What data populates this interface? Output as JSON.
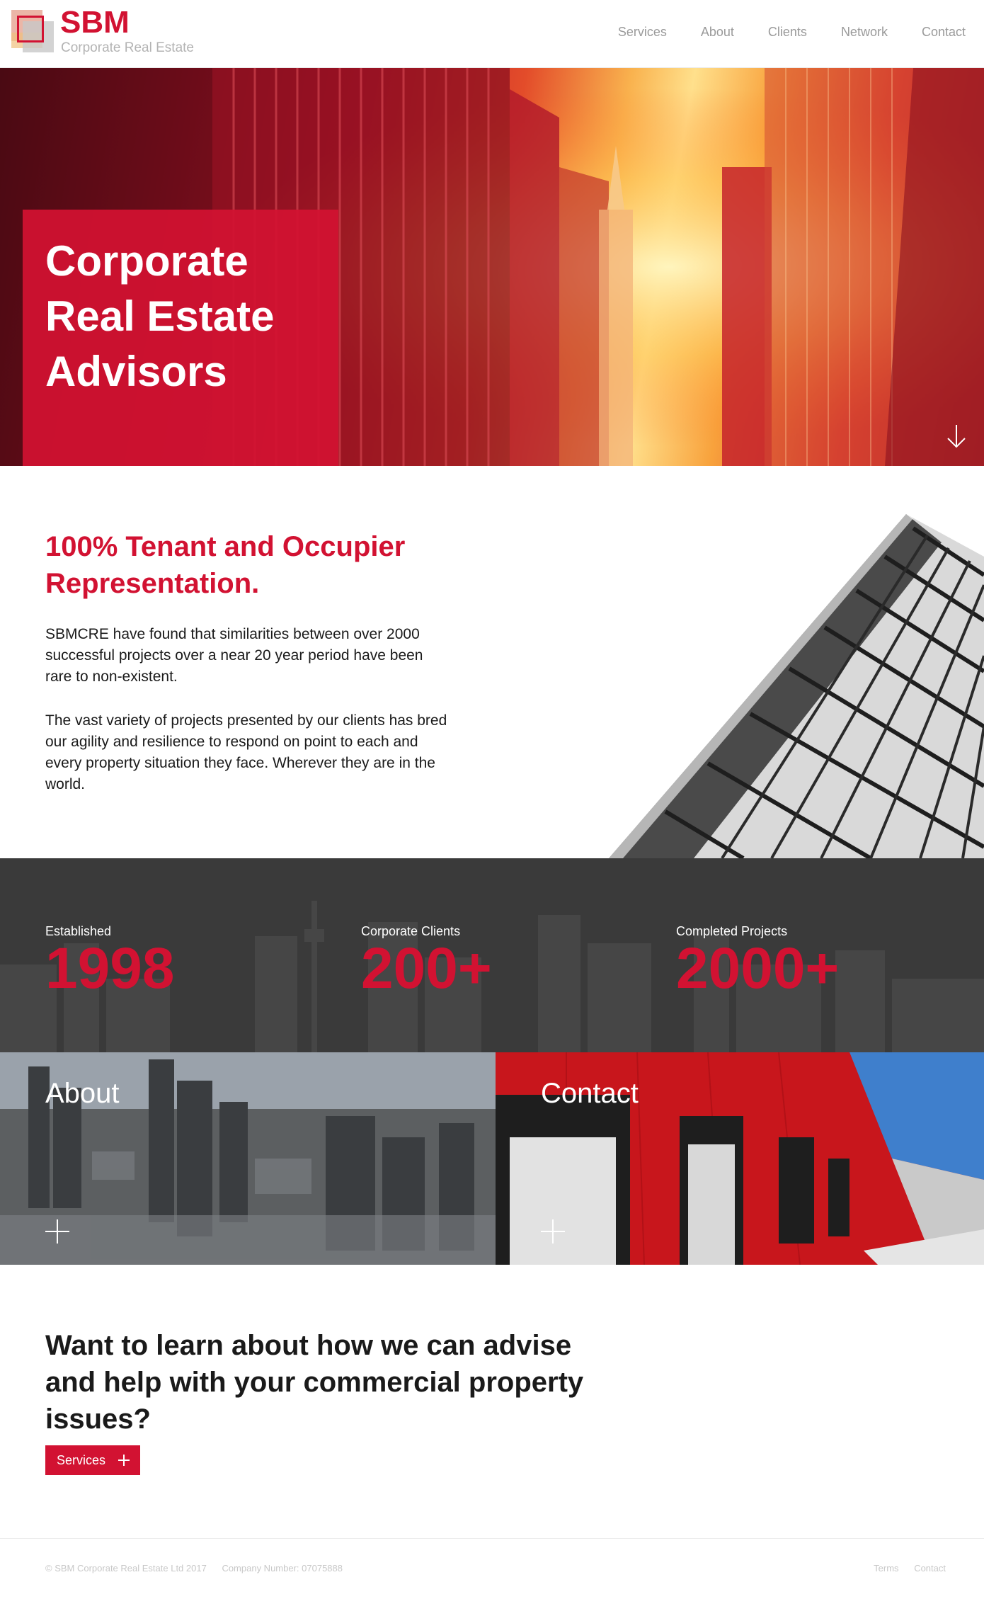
{
  "brand": {
    "name": "SBM",
    "tagline": "Corporate Real Estate",
    "color": "#d21232"
  },
  "nav": {
    "items": [
      "Services",
      "About",
      "Clients",
      "Network",
      "Contact"
    ]
  },
  "hero": {
    "title_lines": [
      "Corporate",
      "Real Estate",
      "Advisors"
    ]
  },
  "intro": {
    "title": "100% Tenant and Occupier Representation.",
    "paragraph1": "SBMCRE have found that similarities between over 2000 successful projects over a near 20 year period have been rare to non-existent.",
    "paragraph2": "The vast variety of projects presented by our clients has bred our agility and resilience to respond on point to each and every property situation they face. Wherever they are in the world."
  },
  "stats": [
    {
      "label": "Established",
      "value": "1998"
    },
    {
      "label": "Corporate Clients",
      "value": "200+"
    },
    {
      "label": "Completed Projects",
      "value": "2000+"
    }
  ],
  "tiles": {
    "about": "About",
    "contact": "Contact"
  },
  "cta": {
    "title_lines": [
      "Want to learn about how we can advise",
      "and help with your commercial property issues?"
    ],
    "button_label": "Services"
  },
  "footer": {
    "copyright": "© SBM Corporate Real Estate Ltd 2017",
    "company_number": "Company Number: 07075888",
    "links": [
      "Terms",
      "Contact"
    ]
  },
  "icons": {
    "hero": "down-arrow-icon",
    "tiles": "plus-icon",
    "button": "plus-icon"
  }
}
